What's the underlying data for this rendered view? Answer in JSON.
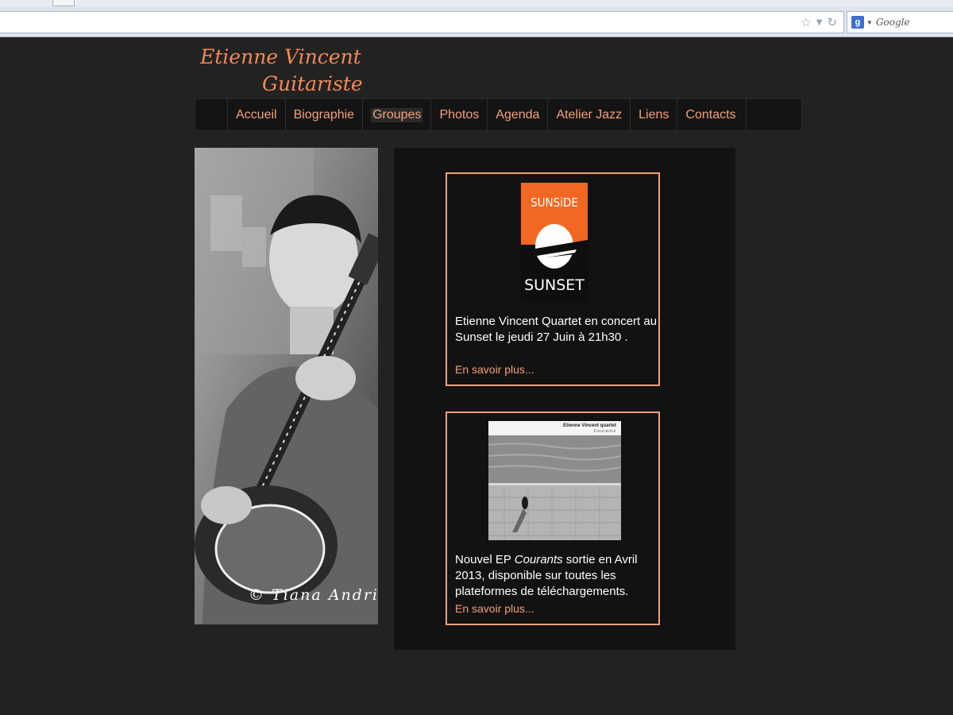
{
  "browser": {
    "search_placeholder": "Google",
    "search_engine_icon": "google-icon"
  },
  "site": {
    "logo_line1": "Etienne Vincent",
    "logo_line2": "Guitariste"
  },
  "nav": {
    "items": [
      "Accueil",
      "Biographie",
      "Groupes",
      "Photos",
      "Agenda",
      "Atelier Jazz",
      "Liens",
      "Contacts"
    ],
    "active": "Groupes"
  },
  "photo": {
    "credit": "© Tiana Andri"
  },
  "news": [
    {
      "image_text_top": "SUNSiDE",
      "image_text_bottom": "SUNSET",
      "text": "Etienne Vincent Quartet en concert au Sunset le jeudi 27 Juin à 21h30 .",
      "link": "En savoir plus..."
    },
    {
      "image_text_artist": "Etienne Vincent quartet",
      "image_text_title": "Courants",
      "text_before": "Nouvel EP ",
      "text_italic": "Courants",
      "text_after": " sortie en Avril 2013, disponible sur toutes les plateformes de téléchargements.",
      "link": "En savoir plus..."
    }
  ],
  "colors": {
    "accent": "#f4a07a",
    "background": "#222222",
    "panel": "#121212",
    "sunside_orange": "#f26822"
  }
}
